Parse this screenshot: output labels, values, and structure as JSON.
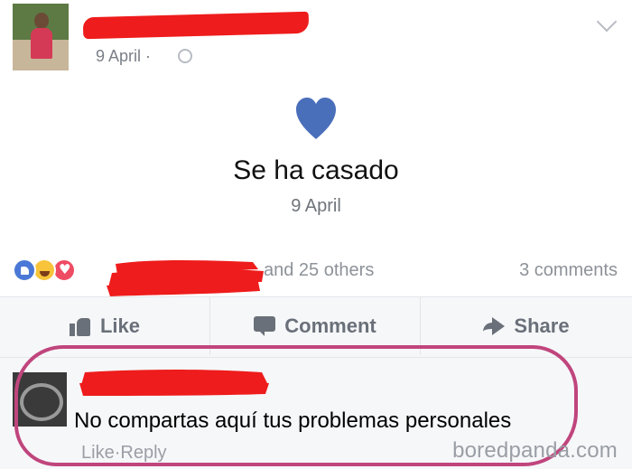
{
  "post": {
    "date": "9 April",
    "separator": " ·",
    "icons": {
      "audience": "globe-icon",
      "menu": "chevron-down-icon",
      "event": "heart-icon"
    }
  },
  "life_event": {
    "title": "Se ha casado",
    "date": "9 April"
  },
  "reactions": {
    "types": [
      "like",
      "haha",
      "love"
    ],
    "likers_suffix": "and 25 others",
    "comments_count": "3 comments"
  },
  "actions": {
    "like": "Like",
    "comment": "Comment",
    "share": "Share"
  },
  "comment": {
    "text": "No compartas aquí tus problemas personales",
    "like_label": "Like",
    "separator": " · ",
    "reply_label": "Reply"
  },
  "watermark": "boredpanda.com",
  "colors": {
    "redaction": "#ee1c1c",
    "annotation_circle": "#c0457d",
    "heart": "#4a6fba"
  }
}
